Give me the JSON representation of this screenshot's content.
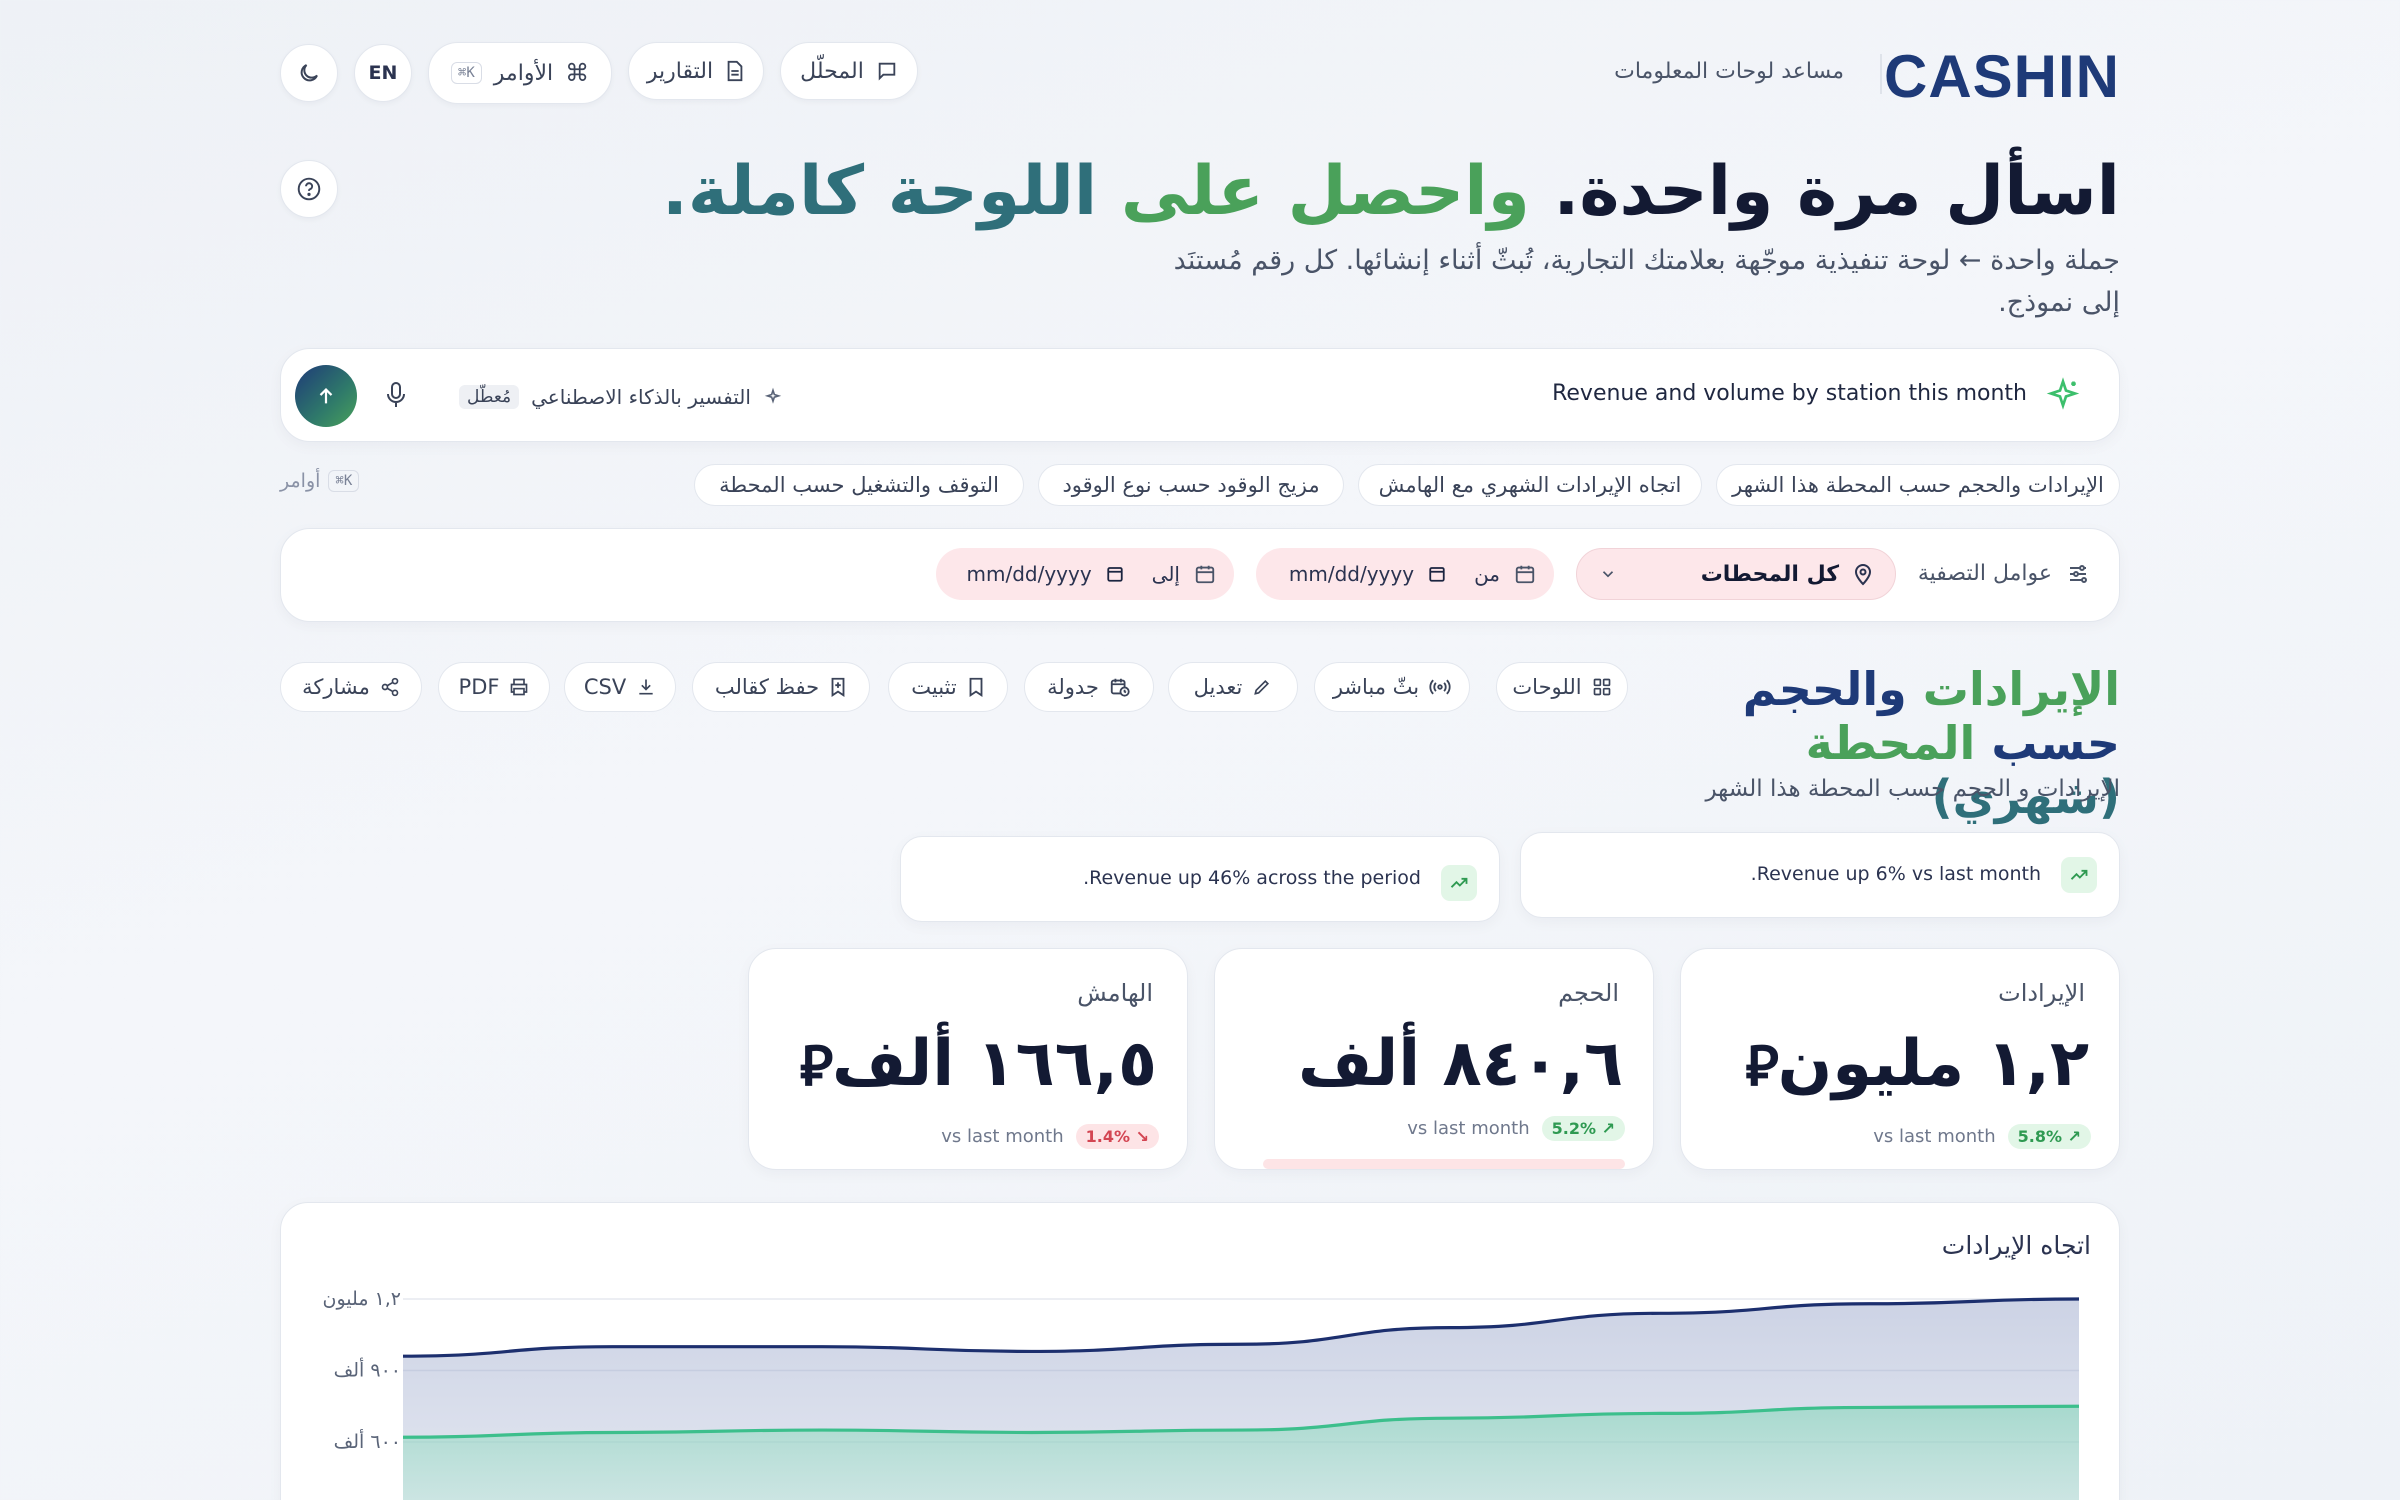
{
  "brand": {
    "logo": "CASHIN",
    "tagline": "مساعد لوحات المعلومات"
  },
  "topnav": {
    "analyst": "المحلّل",
    "reports": "التقارير",
    "commands": "الأوامر",
    "commands_kbd": "K⌘",
    "lang": "EN"
  },
  "hero": {
    "title_part1": "اسأل مرة واحدة.",
    "title_part2": "واحصل على",
    "title_part3": "اللوحة كاملة.",
    "subtitle": "جملة واحدة ← لوحة تنفيذية موجّهة بعلامتك التجارية، تُبثّ أثناء إنشائها. كل رقم مُستنَد إلى نموذج."
  },
  "prompt": {
    "text": "Revenue and volume by station this month",
    "ai_explain": "التفسير بالذكاء الاصطناعي",
    "ai_status": "مُعطّل"
  },
  "suggestions": [
    "الإيرادات والحجم حسب المحطة هذا الشهر",
    "اتجاه الإيرادات الشهري مع الهامش",
    "مزيج الوقود حسب نوع الوقود",
    "التوقف والتشغيل حسب المحطة"
  ],
  "commands_hint": {
    "label": "أوامر",
    "kbd": "K⌘"
  },
  "filters": {
    "label": "عوامل التصفية",
    "station": "كل المحطات",
    "from_label": "من",
    "to_label": "إلى",
    "date_placeholder": "mm/dd/yyyy"
  },
  "dashboard": {
    "title_part1": "الإيرادات",
    "title_part2": "والحجم حسب",
    "title_part3": "المحطة",
    "title_part4": "(شهري)",
    "subtitle": "الإيرادات و الحجم حسب المحطة هذا الشهر"
  },
  "toolbar": {
    "boards": "اللوحات",
    "live": "بثّ مباشر",
    "edit": "تعديل",
    "schedule": "جدولة",
    "pin": "تثبيت",
    "save_template": "حفظ كقالب",
    "csv": "CSV",
    "pdf": "PDF",
    "share": "مشاركة"
  },
  "insights": [
    "Revenue up 6% vs last month.",
    "Revenue up 46% across the period."
  ],
  "kpis": [
    {
      "label": "الإيرادات",
      "value": "١,٢ مليون",
      "currency": "⃁",
      "change": "5.8%",
      "direction": "up",
      "compare": "vs last month"
    },
    {
      "label": "الحجم",
      "value": "٨٤٠,٦ ألف",
      "currency": "",
      "change": "5.2%",
      "direction": "up",
      "compare": "vs last month"
    },
    {
      "label": "الهامش",
      "value": "١٦٦,٥ ألف",
      "currency": "⃁",
      "change": "1.4%",
      "direction": "down",
      "compare": "vs last month"
    }
  ],
  "colors": {
    "navy": "#1e3a78",
    "green": "#4aa15a",
    "teal": "#2f6f7a",
    "revenue_line": "#1c2f6e",
    "margin_line": "#3cbf8c"
  },
  "chart_data": {
    "type": "area",
    "title": "اتجاه الإيرادات",
    "y_tick_labels": [
      "١,٢ مليون",
      "٩٠٠ ألف",
      "٦٠٠ ألف"
    ],
    "ylim": [
      300000,
      1200000
    ],
    "series": [
      {
        "values": [
          960000,
          1000000,
          1000000,
          980000,
          1010000,
          1080000,
          1140000,
          1180000,
          1200000
        ]
      },
      {
        "values": [
          620000,
          640000,
          650000,
          640000,
          650000,
          700000,
          720000,
          745000,
          750000
        ]
      }
    ]
  }
}
